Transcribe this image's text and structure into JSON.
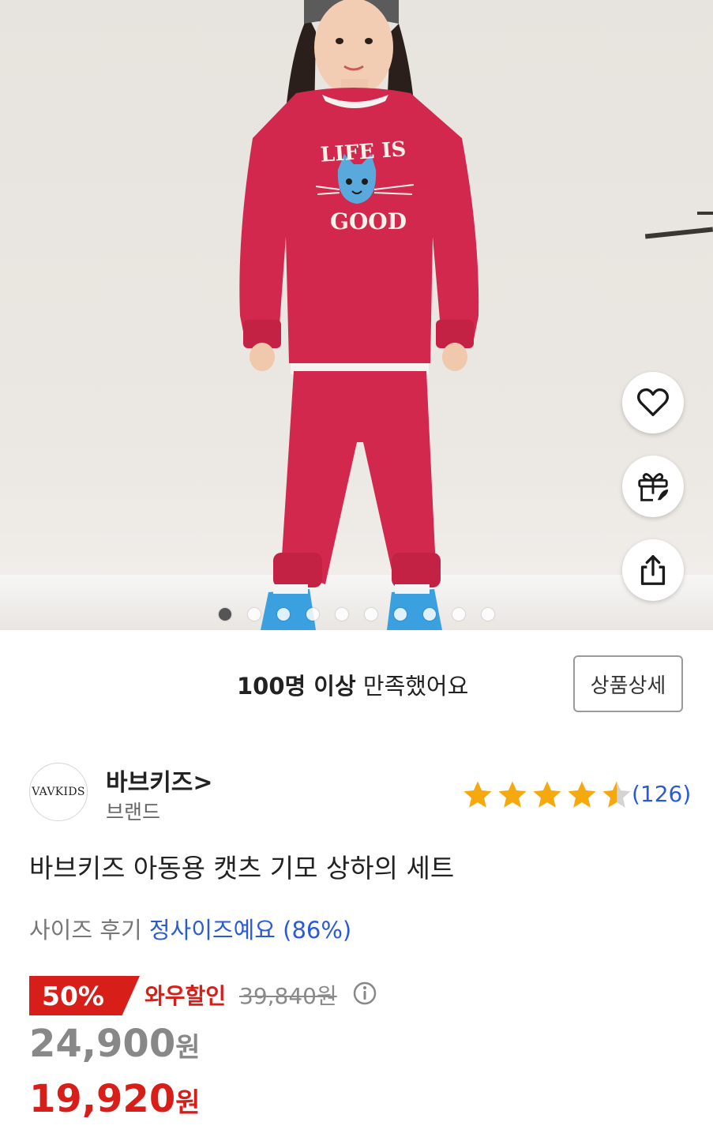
{
  "product_image": {
    "graphic_text": [
      "LIFE IS",
      "GOOD"
    ],
    "carousel": {
      "total": 10,
      "active_index": 0
    }
  },
  "actions": {
    "wishlist_icon": "heart-icon",
    "gift_icon": "gift-icon",
    "share_icon": "share-icon"
  },
  "satisfaction": {
    "bold": "100명 이상",
    "rest": " 만족했어요",
    "detail_button": "상품상세"
  },
  "brand": {
    "logo_text": "VAVKIDS",
    "name": "바브키즈",
    "chevron": ">",
    "label": "브랜드"
  },
  "rating": {
    "stars": 4.5,
    "review_count": "(126)",
    "colors": {
      "star": "#f6a80f",
      "empty": "#d4d4d4"
    }
  },
  "title": "바브키즈 아동용 캣츠 기모 상하의 세트",
  "size_review": {
    "label": "사이즈 후기",
    "value": "정사이즈예요 (86%)"
  },
  "price": {
    "discount_badge": "50%",
    "wow_label": "와우할인",
    "original_price": "39,840원",
    "price": "24,900",
    "wow_price": "19,920",
    "unit": "원",
    "colors": {
      "accent": "#d81e18",
      "link": "#2a5bd7"
    }
  }
}
